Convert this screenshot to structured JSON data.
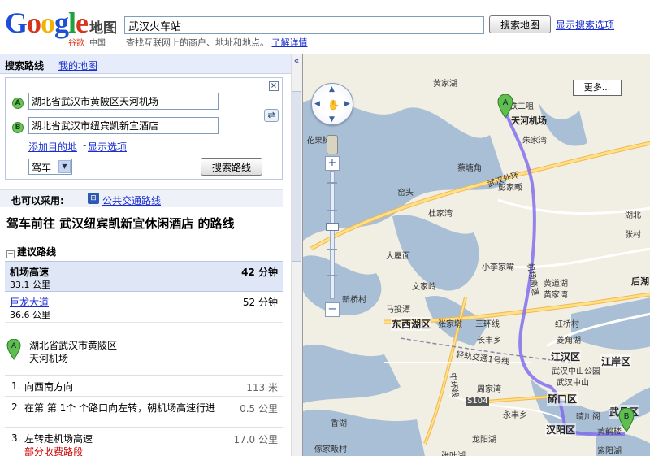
{
  "header": {
    "logo_text": "Google",
    "logo_maps": "地图",
    "logo_sub": "谷歌",
    "logo_sub2": "中国",
    "search_value": "武汉火车站",
    "search_button": "搜索地图",
    "show_options": "显示搜索选项",
    "hint": "查找互联网上的商户、地址和地点。",
    "hint_link": "了解详情"
  },
  "tabs": {
    "search_routes": "搜索路线",
    "my_maps": "我的地图"
  },
  "directions": {
    "marker_a": "A",
    "marker_b": "B",
    "from": "湖北省武汉市黄陂区天河机场",
    "to": "湖北省武汉市纽宾凯新宜酒店",
    "add_destination": "添加目的地",
    "separator": "-",
    "show_options": "显示选项",
    "mode": "驾车",
    "route_button": "搜索路线",
    "close": "×",
    "swap": "⇄"
  },
  "alternatives": {
    "label": "也可以采用:",
    "transit_icon": "bus-icon",
    "transit_link": "公共交通路线"
  },
  "route_title": "驾车前往  武汉纽宾凯新宜休闲酒店  的路线",
  "suggested": {
    "header": "建议路线",
    "toggle": "−",
    "routes": [
      {
        "name": "机场高速",
        "distance": "33.1 公里",
        "time": "42 分钟"
      },
      {
        "name": "巨龙大道",
        "distance": "36.6 公里",
        "time": "52 分钟"
      }
    ]
  },
  "start": {
    "line1": "湖北省武汉市黄陂区",
    "line2": "天河机场"
  },
  "steps": [
    {
      "num": "1.",
      "text": "向西南方向",
      "dist": "113 米"
    },
    {
      "num": "2.",
      "text": "在第 第 1个 个路口向左转，朝机场高速行进",
      "dist": "0.5 公里"
    },
    {
      "num": "3.",
      "text": "左转走机场高速",
      "toll": "部分收费路段",
      "dist": "17.0 公里"
    }
  ],
  "map": {
    "more_button": "更多...",
    "labels": [
      "铁二咀",
      "天河机场",
      "朱家湾",
      "黄家湖",
      "武汉外环",
      "蔡塘角",
      "彭家畈",
      "窑头",
      "杜家湾",
      "机场高速",
      "大屋面",
      "小李家嘴",
      "黄道湖",
      "文家岭",
      "黄家湾",
      "新桥村",
      "马投潭",
      "东西湖区",
      "张家墩",
      "三环线",
      "长丰乡",
      "轻轨交通1号线",
      "江汉区",
      "江岸区",
      "武汉中山公园",
      "周家湾",
      "中环线",
      "S104",
      "永丰乡",
      "硚口区",
      "汉阳区",
      "晴川阁",
      "武昌区",
      "黄鹤楼",
      "紫阳湖",
      "傢家畈村",
      "张叶湖",
      "后湖",
      "张村",
      "红桥村",
      "菱角湖",
      "花果树",
      "湖北",
      "武汉中山",
      "龙阳湖",
      "香湖"
    ],
    "pin_a": "A",
    "pin_b": "B"
  },
  "colors": {
    "route": "#7b68ee",
    "highway": "#f7c35c",
    "water": "#99b3cc",
    "land": "#f1eee4",
    "link": "#1a2ed0"
  }
}
